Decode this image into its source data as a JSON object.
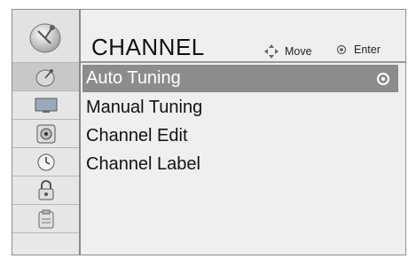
{
  "header": {
    "title": "CHANNEL",
    "move_label": "Move",
    "enter_label": "Enter"
  },
  "sidebar": {
    "items": [
      {
        "icon": "satellite-dish-icon"
      },
      {
        "icon": "picture-icon"
      },
      {
        "icon": "audio-icon"
      },
      {
        "icon": "time-icon"
      },
      {
        "icon": "lock-icon"
      },
      {
        "icon": "option-icon"
      }
    ],
    "active_index": 0
  },
  "menu": {
    "items": [
      {
        "label": "Auto Tuning"
      },
      {
        "label": "Manual Tuning"
      },
      {
        "label": "Channel Edit"
      },
      {
        "label": "Channel Label"
      }
    ],
    "selected_index": 0
  },
  "colors": {
    "selected_bg": "#8c8c8c",
    "panel_bg": "#efefef",
    "sidebar_bg": "#e8e8e8"
  }
}
